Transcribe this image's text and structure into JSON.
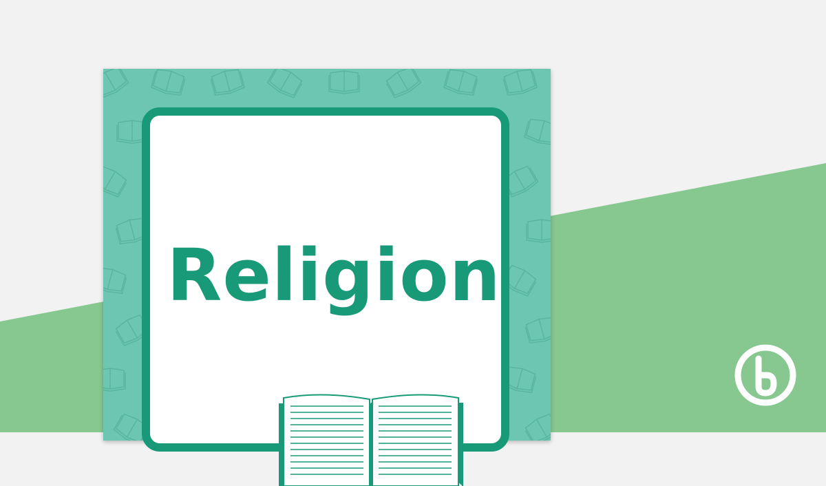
{
  "poster": {
    "title": "Religion",
    "colors": {
      "pattern_bg": "#6cc6b1",
      "pattern_stroke": "#58b39c",
      "frame": "#189a78",
      "card_bg": "#ffffff",
      "title": "#189a78"
    },
    "pattern_icon": "open-book-icon",
    "illustration_icon": "open-book-icon"
  },
  "background": {
    "light": "#f2f2f2",
    "green": "#86c890"
  },
  "brand": {
    "logo_icon": "teach-starter-logo-icon",
    "logo_color": "#ffffff"
  }
}
